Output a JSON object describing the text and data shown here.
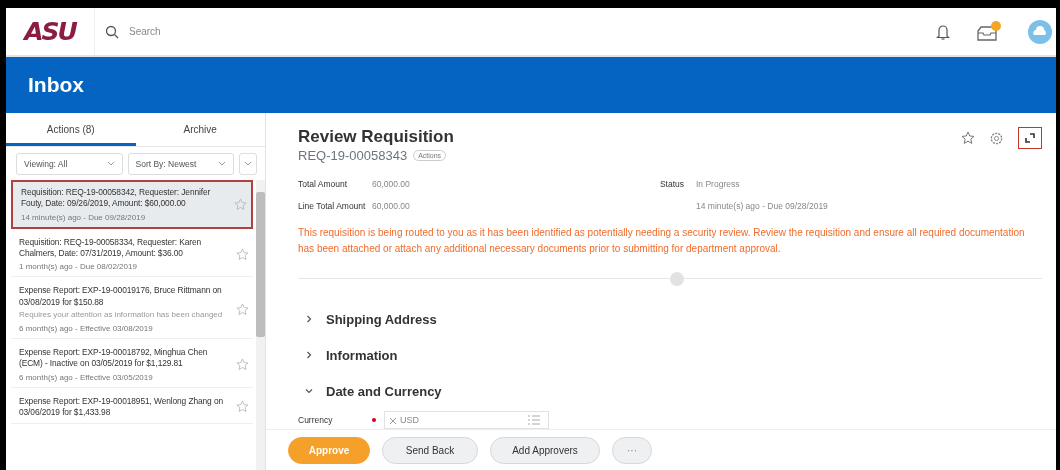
{
  "header": {
    "logo": "ASU",
    "search": {
      "placeholder": "Search"
    }
  },
  "banner": {
    "title": "Inbox"
  },
  "inbox": {
    "tabs": [
      {
        "label": "Actions (8)",
        "selected": true
      },
      {
        "label": "Archive",
        "selected": false
      }
    ],
    "filters": [
      {
        "label": "Viewing: All"
      },
      {
        "label": "Sort By: Newest"
      }
    ],
    "items": [
      {
        "title": "Requisition: REQ-19-00058342, Requester: Jennifer Fouty, Date: 09/26/2019, Amount: $60,000.00",
        "meta": "14 minute(s) ago - Due 09/28/2019",
        "selected": true
      },
      {
        "title": "Requisition: REQ-19-00058334, Requester: Karen Chalmers, Date: 07/31/2019, Amount: $36.00",
        "meta": "1 month(s) ago - Due 08/02/2019",
        "selected": false
      },
      {
        "title": "Expense Report: EXP-19-00019176, Bruce Rittmann on 03/08/2019 for $150.88",
        "note": "Requires your attention as information has been changed",
        "meta": "6 month(s) ago - Effective 03/08/2019",
        "selected": false
      },
      {
        "title": "Expense Report: EXP-19-00018792, Minghua Chen (ECM) - Inactive on 03/05/2019 for $1,129.81",
        "meta": "6 month(s) ago - Effective 03/05/2019",
        "selected": false
      },
      {
        "title": "Expense Report: EXP-19-00018951, Wenlong Zhang on 03/06/2019 for $1,433.98",
        "selected": false
      }
    ]
  },
  "detail": {
    "title": "Review Requisition",
    "id": "REQ-19-00058343",
    "actions": "Actions",
    "fields": [
      {
        "label": "Total Amount",
        "value": "60,000.00"
      },
      {
        "label": "Line Total Amount",
        "value": "60,000.00"
      }
    ],
    "status": {
      "label": "Status",
      "value": "In Progress",
      "meta": "14 minute(s) ago - Due 09/28/2019"
    },
    "warning": "This requisition is being routed to you as it has been identified as potentially needing a security review.  Review the requisition and ensure all required documentation has been attached or attach any additional necessary documents prior to submitting for department approval.",
    "sections": [
      {
        "title": "Shipping Address",
        "expanded": false
      },
      {
        "title": "Information",
        "expanded": false
      },
      {
        "title": "Date and Currency",
        "expanded": true
      }
    ],
    "currency": {
      "label": "Currency",
      "required": true,
      "value": "USD"
    },
    "buttons": [
      {
        "label": "Approve",
        "kind": "primary"
      },
      {
        "label": "Send Back",
        "kind": "secondary"
      },
      {
        "label": "Add Approvers",
        "kind": "secondary"
      },
      {
        "label": "···",
        "kind": "more"
      }
    ]
  }
}
